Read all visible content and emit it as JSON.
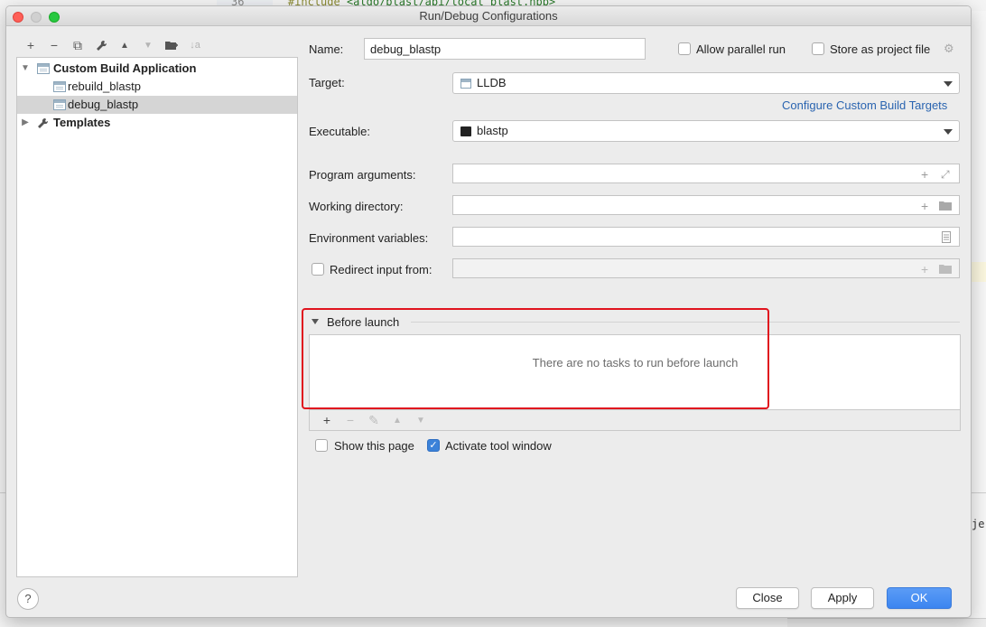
{
  "background": {
    "line_number": "36",
    "code_prefix": "#include ",
    "code_path": "<algo/blast/api/local_blast.hpp>",
    "right_text": "je"
  },
  "window": {
    "title": "Run/Debug Configurations"
  },
  "left_toolbar": {
    "add": "+",
    "remove": "−",
    "copy": "⧉",
    "edit": "🔧",
    "move_up": "▲",
    "move_down": "▼",
    "folder": "▣",
    "sort": "↓a"
  },
  "tree": {
    "group_label": "Custom Build Application",
    "items": [
      {
        "label": "rebuild_blastp"
      },
      {
        "label": "debug_blastp"
      }
    ],
    "templates_label": "Templates"
  },
  "form": {
    "name_label": "Name:",
    "name_value": "debug_blastp",
    "allow_parallel_label": "Allow parallel run",
    "store_project_label": "Store as project file",
    "target_label": "Target:",
    "target_value": "LLDB",
    "configure_link": "Configure Custom Build Targets",
    "executable_label": "Executable:",
    "executable_value": "blastp",
    "program_args_label": "Program arguments:",
    "working_dir_label": "Working directory:",
    "env_vars_label": "Environment variables:",
    "redirect_label": "Redirect input from:"
  },
  "before_launch": {
    "title": "Before launch",
    "empty_text": "There are no tasks to run before launch",
    "toolbar": {
      "add": "+",
      "remove": "−",
      "edit": "✎",
      "up": "▲",
      "down": "▼"
    }
  },
  "footer": {
    "show_page_label": "Show this page",
    "activate_tool_label": "Activate tool window",
    "help": "?",
    "close": "Close",
    "apply": "Apply",
    "ok": "OK"
  }
}
